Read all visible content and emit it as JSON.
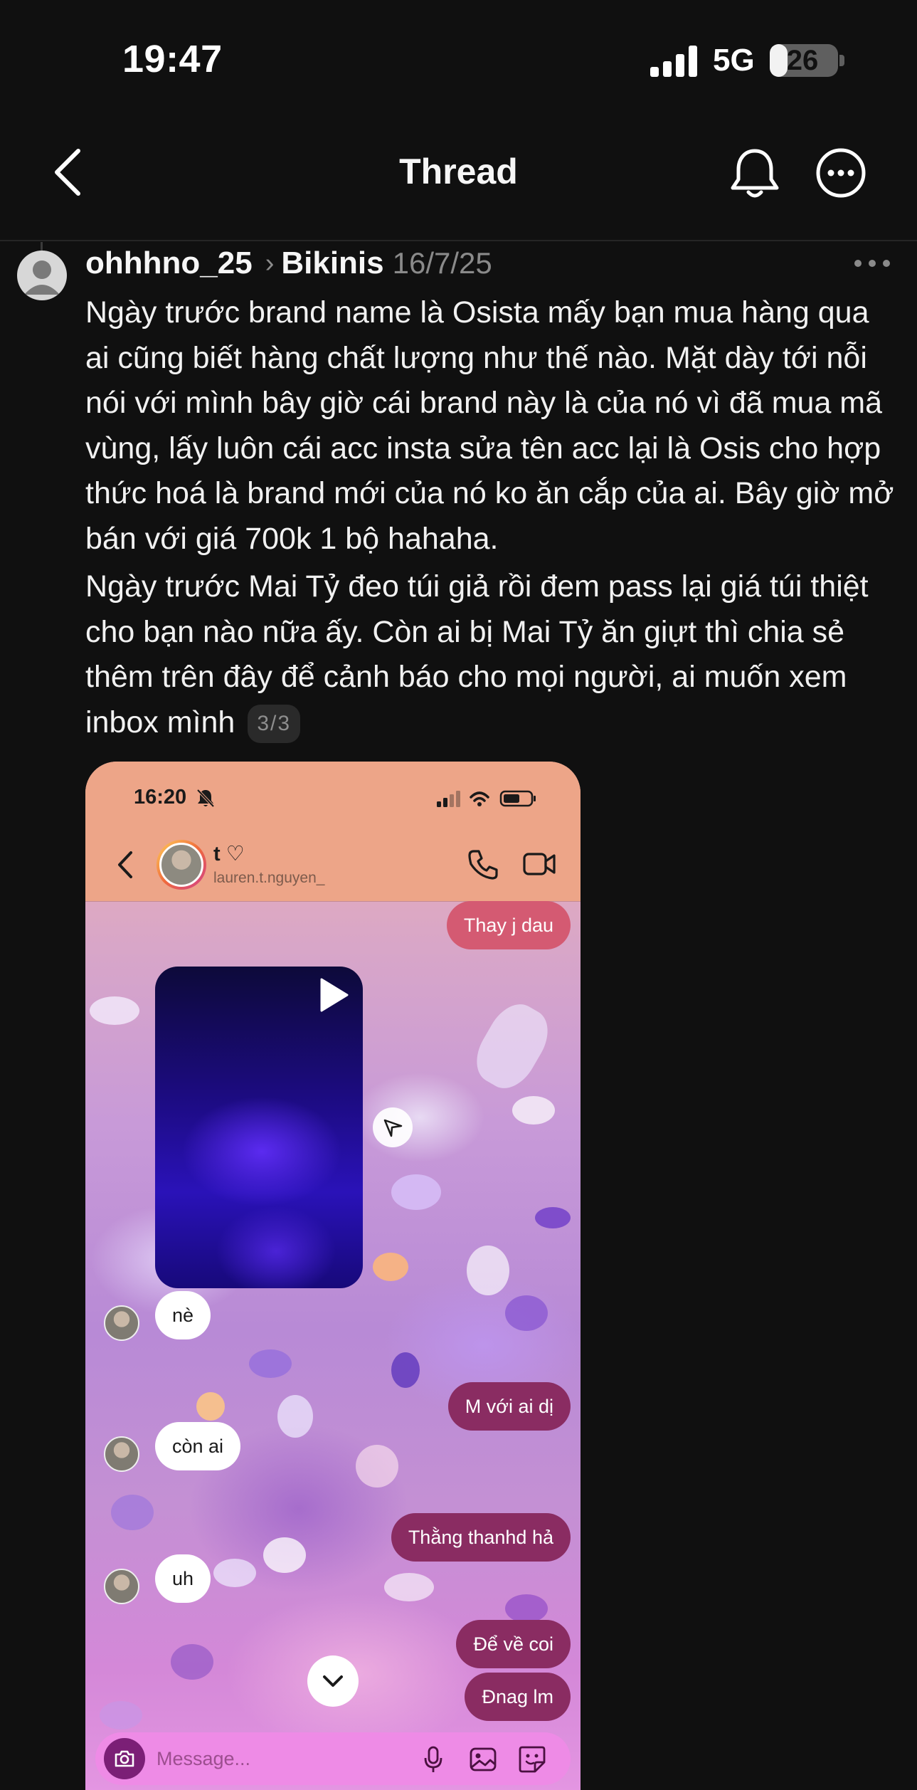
{
  "status_bar": {
    "time": "19:47",
    "network": "5G",
    "battery": "26",
    "battery_level": 0.26
  },
  "nav": {
    "title": "Thread",
    "icons": [
      "chevron-left-icon",
      "bell-icon",
      "more-circle-icon"
    ]
  },
  "post": {
    "username": "ohhhno_25",
    "separator": "›",
    "community": "Bikinis",
    "date": "16/7/25",
    "paragraphs": [
      "Ngày trước brand name là Osista mấy bạn mua hàng qua ai cũng biết hàng chất lượng như thế nào. Mặt dày tới nỗi nói với mình bây giờ cái brand này là của nó vì đã mua mã vùng, lấy luôn cái acc insta sửa tên acc lại là Osis cho hợp thức hoá là brand mới của nó ko ăn cắp của ai. Bây giờ mở bán với giá 700k 1 bộ hahaha.",
      "Ngày trước Mai Tỷ đeo túi giả rồi đem pass lại giá túi thiệt cho bạn nào nữa ấy. Còn ai bị Mai Tỷ ăn giựt thì chia sẻ thêm trên đây để cảnh báo cho mọi người, ai muốn xem inbox mình"
    ],
    "page_indicator": "3/3"
  },
  "screenshot": {
    "status_time": "16:20",
    "contact_name": "t ♡",
    "contact_handle": "lauren.t.nguyen_",
    "messages": [
      {
        "from": "me",
        "text": "Thay j dau"
      },
      {
        "from": "them",
        "text": "nè"
      },
      {
        "from": "me",
        "text": "M với ai dị"
      },
      {
        "from": "them",
        "text": "còn ai"
      },
      {
        "from": "me",
        "text": "Thằng thanhd hả"
      },
      {
        "from": "them",
        "text": "uh"
      },
      {
        "from": "me",
        "text": "Để về coi"
      },
      {
        "from": "me",
        "text": "Đnag lm"
      }
    ],
    "composer_placeholder": "Message...",
    "colors": {
      "header": "#eda588",
      "outgoing_bubble": "#8a2c62",
      "incoming_bubble": "#ffffff",
      "composer": "#ee8be6"
    }
  }
}
